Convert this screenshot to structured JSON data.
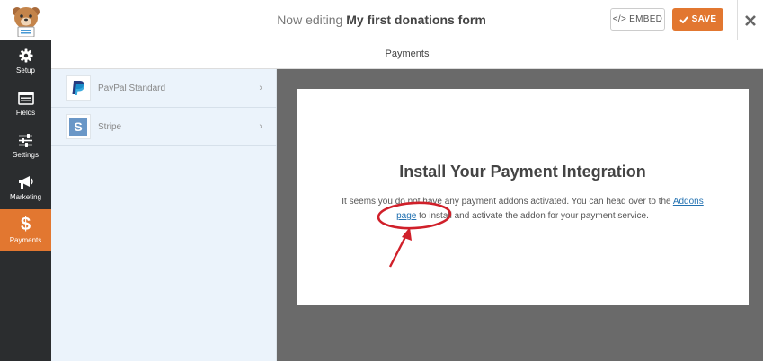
{
  "header": {
    "editing_prefix": "Now editing",
    "form_name": "My first donations form",
    "embed_label": "EMBED",
    "save_label": "SAVE"
  },
  "sidebar": {
    "items": [
      {
        "label": "Setup",
        "icon": "gear-icon"
      },
      {
        "label": "Fields",
        "icon": "fields-icon"
      },
      {
        "label": "Settings",
        "icon": "sliders-icon"
      },
      {
        "label": "Marketing",
        "icon": "megaphone-icon"
      },
      {
        "label": "Payments",
        "icon": "dollar-icon",
        "active": true
      }
    ]
  },
  "panel": {
    "title": "Payments"
  },
  "gateways": [
    {
      "label": "PayPal Standard",
      "icon": "paypal-icon"
    },
    {
      "label": "Stripe",
      "icon": "stripe-icon"
    }
  ],
  "notice": {
    "heading": "Install Your Payment Integration",
    "text_before": "It seems you do not have any payment addons activated. You can head over to the ",
    "link_text": "Addons page",
    "text_after": " to install and activate the addon for your payment service."
  },
  "colors": {
    "accent": "#e27730",
    "sidebar_bg": "#2b2d2f",
    "annotation": "#d0202a"
  }
}
